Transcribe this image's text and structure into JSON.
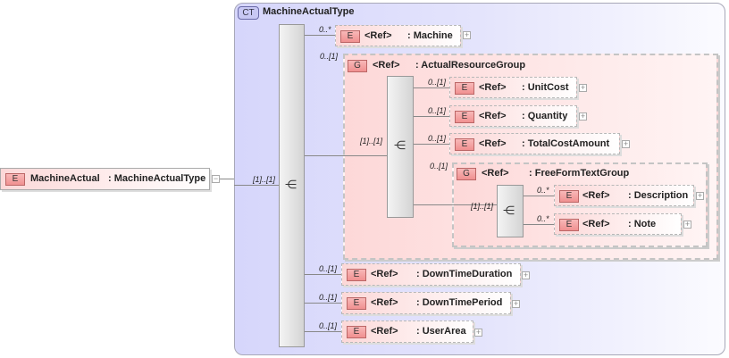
{
  "root": {
    "badge": "E",
    "name": "MachineActual",
    "type": ": MachineActualType",
    "toggle": "−",
    "card": "[1]..[1]"
  },
  "ct": {
    "badge": "CT",
    "title": "MachineActualType"
  },
  "seq_icon": "⋲",
  "machine": {
    "badge": "E",
    "ref": "<Ref>",
    "name": ": Machine",
    "card": "0..*"
  },
  "arg": {
    "badge": "G",
    "ref": "<Ref>",
    "name": ": ActualResourceGroup",
    "card": "0..[1]",
    "seq_card": "[1]..[1]",
    "items": [
      {
        "badge": "E",
        "ref": "<Ref>",
        "name": ": UnitCost",
        "card": "0..[1]"
      },
      {
        "badge": "E",
        "ref": "<Ref>",
        "name": ": Quantity",
        "card": "0..[1]"
      },
      {
        "badge": "E",
        "ref": "<Ref>",
        "name": ": TotalCostAmount",
        "card": "0..[1]"
      }
    ]
  },
  "fftg": {
    "badge": "G",
    "ref": "<Ref>",
    "name": ": FreeFormTextGroup",
    "card": "0..[1]",
    "seq_card": "[1]..[1]",
    "items": [
      {
        "badge": "E",
        "ref": "<Ref>",
        "name": ": Description",
        "card": "0..*"
      },
      {
        "badge": "E",
        "ref": "<Ref>",
        "name": ": Note",
        "card": "0..*"
      }
    ]
  },
  "tail": [
    {
      "badge": "E",
      "ref": "<Ref>",
      "name": ": DownTimeDuration",
      "card": "0..[1]"
    },
    {
      "badge": "E",
      "ref": "<Ref>",
      "name": ": DownTimePeriod",
      "card": "0..[1]"
    },
    {
      "badge": "E",
      "ref": "<Ref>",
      "name": ": UserArea",
      "card": "0..[1]"
    }
  ],
  "plus": "+"
}
